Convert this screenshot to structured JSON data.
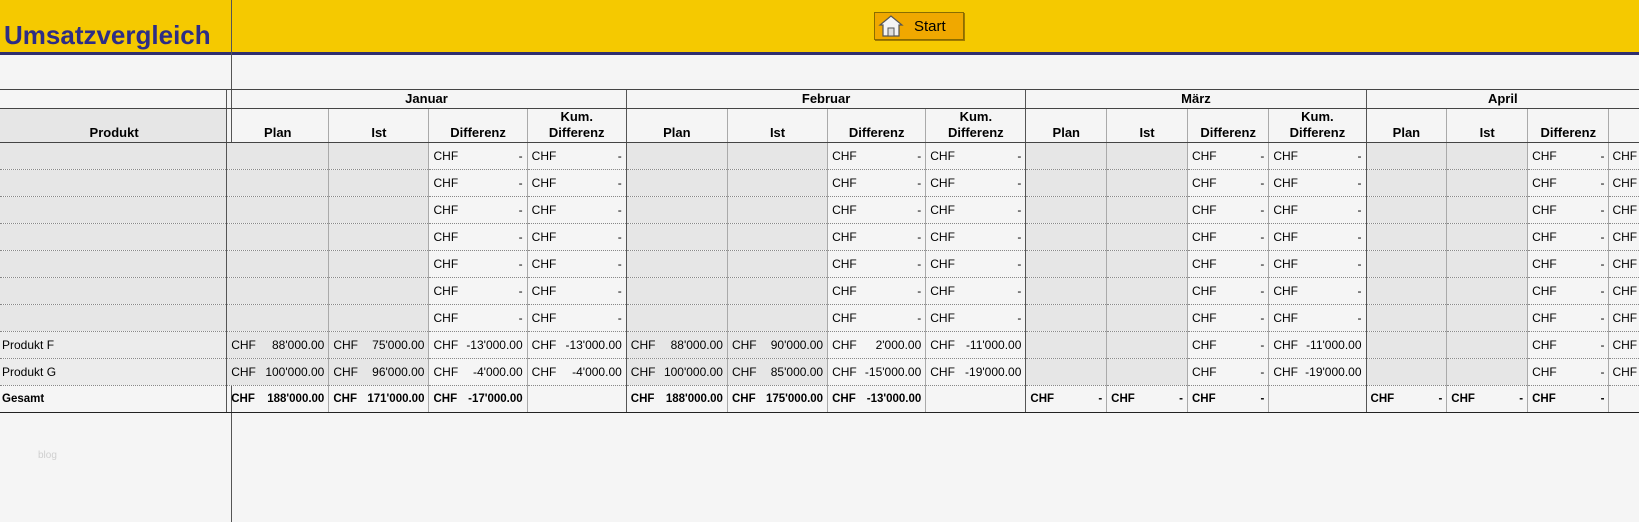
{
  "header": {
    "title": "Umsatzvergleich",
    "start_label": "Start"
  },
  "months": [
    "Januar",
    "Februar",
    "März",
    "April"
  ],
  "columns": {
    "produkt": "Produkt",
    "plan": "Plan",
    "ist": "Ist",
    "differenz": "Differenz",
    "kum_line1": "Kum.",
    "kum_line2": "Differenz"
  },
  "currency": "CHF",
  "dash": "-",
  "rows": [
    {
      "name": "Produkt F",
      "jan": {
        "plan": "88'000.00",
        "ist": "75'000.00",
        "diff": "-13'000.00",
        "kum": "-13'000.00"
      },
      "feb": {
        "plan": "88'000.00",
        "ist": "90'000.00",
        "diff": "2'000.00",
        "kum": "-11'000.00"
      },
      "mar": {
        "diff": "-",
        "kum": "-11'000.00"
      },
      "apr": {
        "diff": "-"
      }
    },
    {
      "name": "Produkt G",
      "jan": {
        "plan": "100'000.00",
        "ist": "96'000.00",
        "diff": "-4'000.00",
        "kum": "-4'000.00"
      },
      "feb": {
        "plan": "100'000.00",
        "ist": "85'000.00",
        "diff": "-15'000.00",
        "kum": "-19'000.00"
      },
      "mar": {
        "diff": "-",
        "kum": "-19'000.00"
      },
      "apr": {
        "diff": "-"
      }
    }
  ],
  "total": {
    "label": "Gesamt",
    "jan": {
      "plan": "188'000.00",
      "ist": "171'000.00",
      "diff": "-17'000.00"
    },
    "feb": {
      "plan": "188'000.00",
      "ist": "175'000.00",
      "diff": "-13'000.00"
    },
    "mar": {
      "plan": "-",
      "ist": "-",
      "diff": "-"
    },
    "apr": {
      "plan": "-",
      "ist": "-",
      "diff": "-"
    }
  },
  "watermark": "blog",
  "colors": {
    "header_bg": "#f5c900",
    "title": "#2d2d86",
    "button": "#f0a800"
  }
}
